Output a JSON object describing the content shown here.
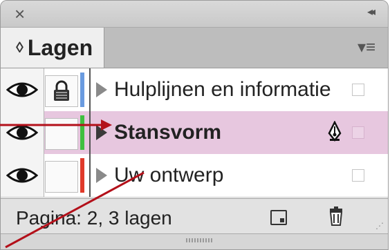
{
  "panel": {
    "tab_label": "Lagen",
    "tab_arrows": "◊",
    "close_glyph": "×",
    "collapse_glyph": "◂◂",
    "menu_glyph": "▾≡"
  },
  "layers": [
    {
      "name": "Hulplijnen en informatie",
      "color": "#6a9be0",
      "locked": true,
      "selected": false
    },
    {
      "name": "Stansvorm",
      "color": "#3fbf3f",
      "locked": false,
      "selected": true
    },
    {
      "name": "Uw ontwerp",
      "color": "#e03a2a",
      "locked": false,
      "selected": false
    }
  ],
  "footer": {
    "status": "Pagina: 2, 3 lagen"
  },
  "colors": {
    "selection": "#e7c7df",
    "callout_line": "#b3101a"
  }
}
